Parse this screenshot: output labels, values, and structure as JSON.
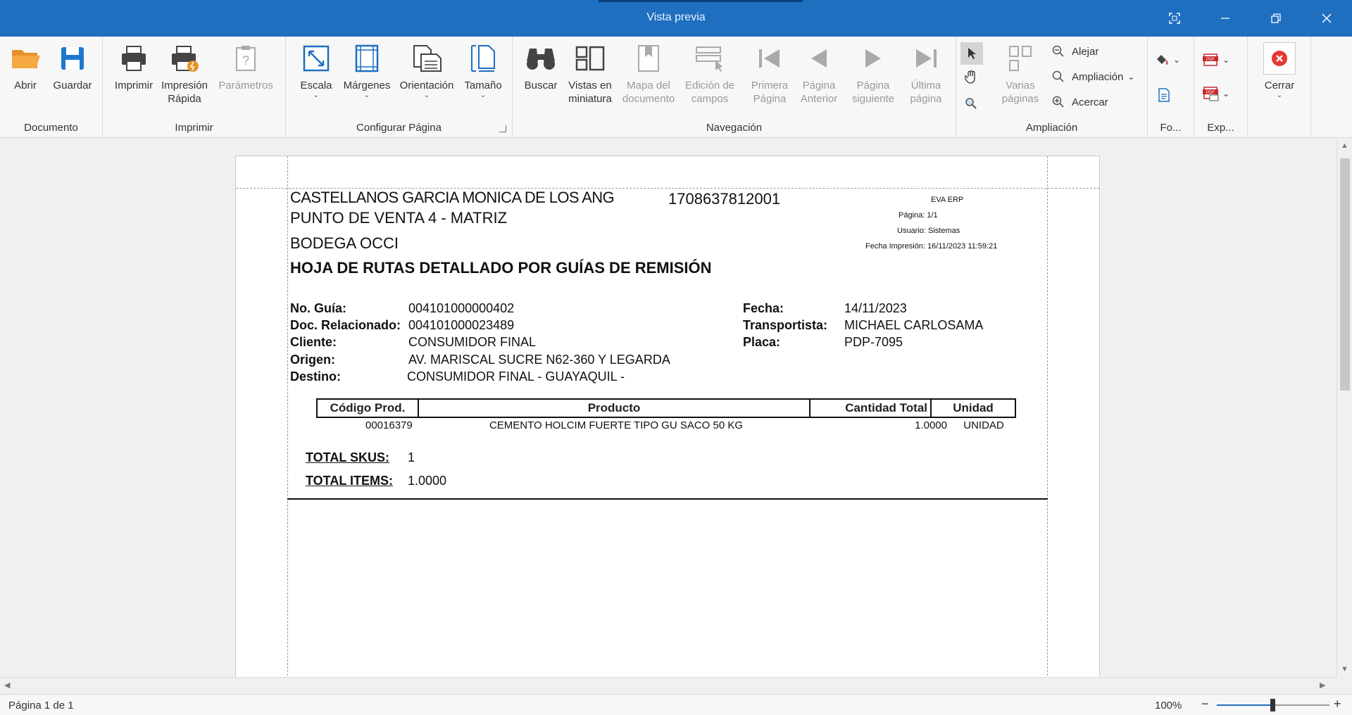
{
  "window": {
    "title": "Vista previa"
  },
  "ribbon": {
    "groups": {
      "documento": "Documento",
      "imprimir": "Imprimir",
      "configurar": "Configurar Página",
      "navegacion": "Navegación",
      "ampliacion": "Ampliación",
      "fondo": "Fo...",
      "exportar": "Exp..."
    },
    "buttons": {
      "abrir": "Abrir",
      "guardar": "Guardar",
      "imprimir": "Imprimir",
      "impresion_rapida": "Impresión Rápida",
      "parametros": "Parámetros",
      "escala": "Escala",
      "margenes": "Márgenes",
      "orientacion": "Orientación",
      "tamano": "Tamaño",
      "buscar": "Buscar",
      "vistas_miniatura": "Vistas en miniatura",
      "mapa_documento": "Mapa del documento",
      "edicion_campos": "Edición de campos",
      "primera_pagina": "Primera Página",
      "pagina_anterior": "Página Anterior",
      "pagina_siguiente": "Página siguiente",
      "ultima_pagina": "Última página",
      "varias_paginas": "Varias páginas",
      "alejar": "Alejar",
      "ampliacion": "Ampliación",
      "acercar": "Acercar",
      "cerrar": "Cerrar"
    }
  },
  "report": {
    "company": "CASTELLANOS GARCIA MONICA DE LOS ANG",
    "ruc": "1708637812001",
    "point_of_sale": "PUNTO DE VENTA 4 - MATRIZ",
    "warehouse": "BODEGA OCCI",
    "title": "HOJA DE RUTAS DETALLADO POR GUÍAS DE REMISIÓN",
    "meta": {
      "system": "EVA ERP",
      "page": "Página: 1/1",
      "user": "Usuario: Sistemas",
      "print_date": "Fecha Impresión: 16/11/2023 11:59:21"
    },
    "fields": {
      "no_guia_label": "No. Guía:",
      "no_guia": "004101000000402",
      "doc_rel_label": "Doc. Relacionado:",
      "doc_rel": "004101000023489",
      "cliente_label": "Cliente:",
      "cliente": "CONSUMIDOR FINAL",
      "origen_label": "Origen:",
      "origen": "AV. MARISCAL SUCRE N62-360 Y LEGARDA",
      "destino_label": "Destino:",
      "destino": "CONSUMIDOR FINAL - GUAYAQUIL -",
      "fecha_label": "Fecha:",
      "fecha": "14/11/2023",
      "transportista_label": "Transportista:",
      "transportista": "MICHAEL CARLOSAMA",
      "placa_label": "Placa:",
      "placa": "PDP-7095"
    },
    "table": {
      "headers": [
        "Código Prod.",
        "Producto",
        "Cantidad Total",
        "Unidad"
      ],
      "rows": [
        [
          "00016379",
          "CEMENTO HOLCIM FUERTE TIPO GU SACO 50 KG",
          "1.0000",
          "UNIDAD"
        ]
      ]
    },
    "totals": {
      "skus_label": "TOTAL SKUS:",
      "skus": "1",
      "items_label": "TOTAL ITEMS:",
      "items": "1.0000"
    }
  },
  "status": {
    "page_info": "Página 1 de 1",
    "zoom": "100%",
    "zoom_level": 0.5
  }
}
